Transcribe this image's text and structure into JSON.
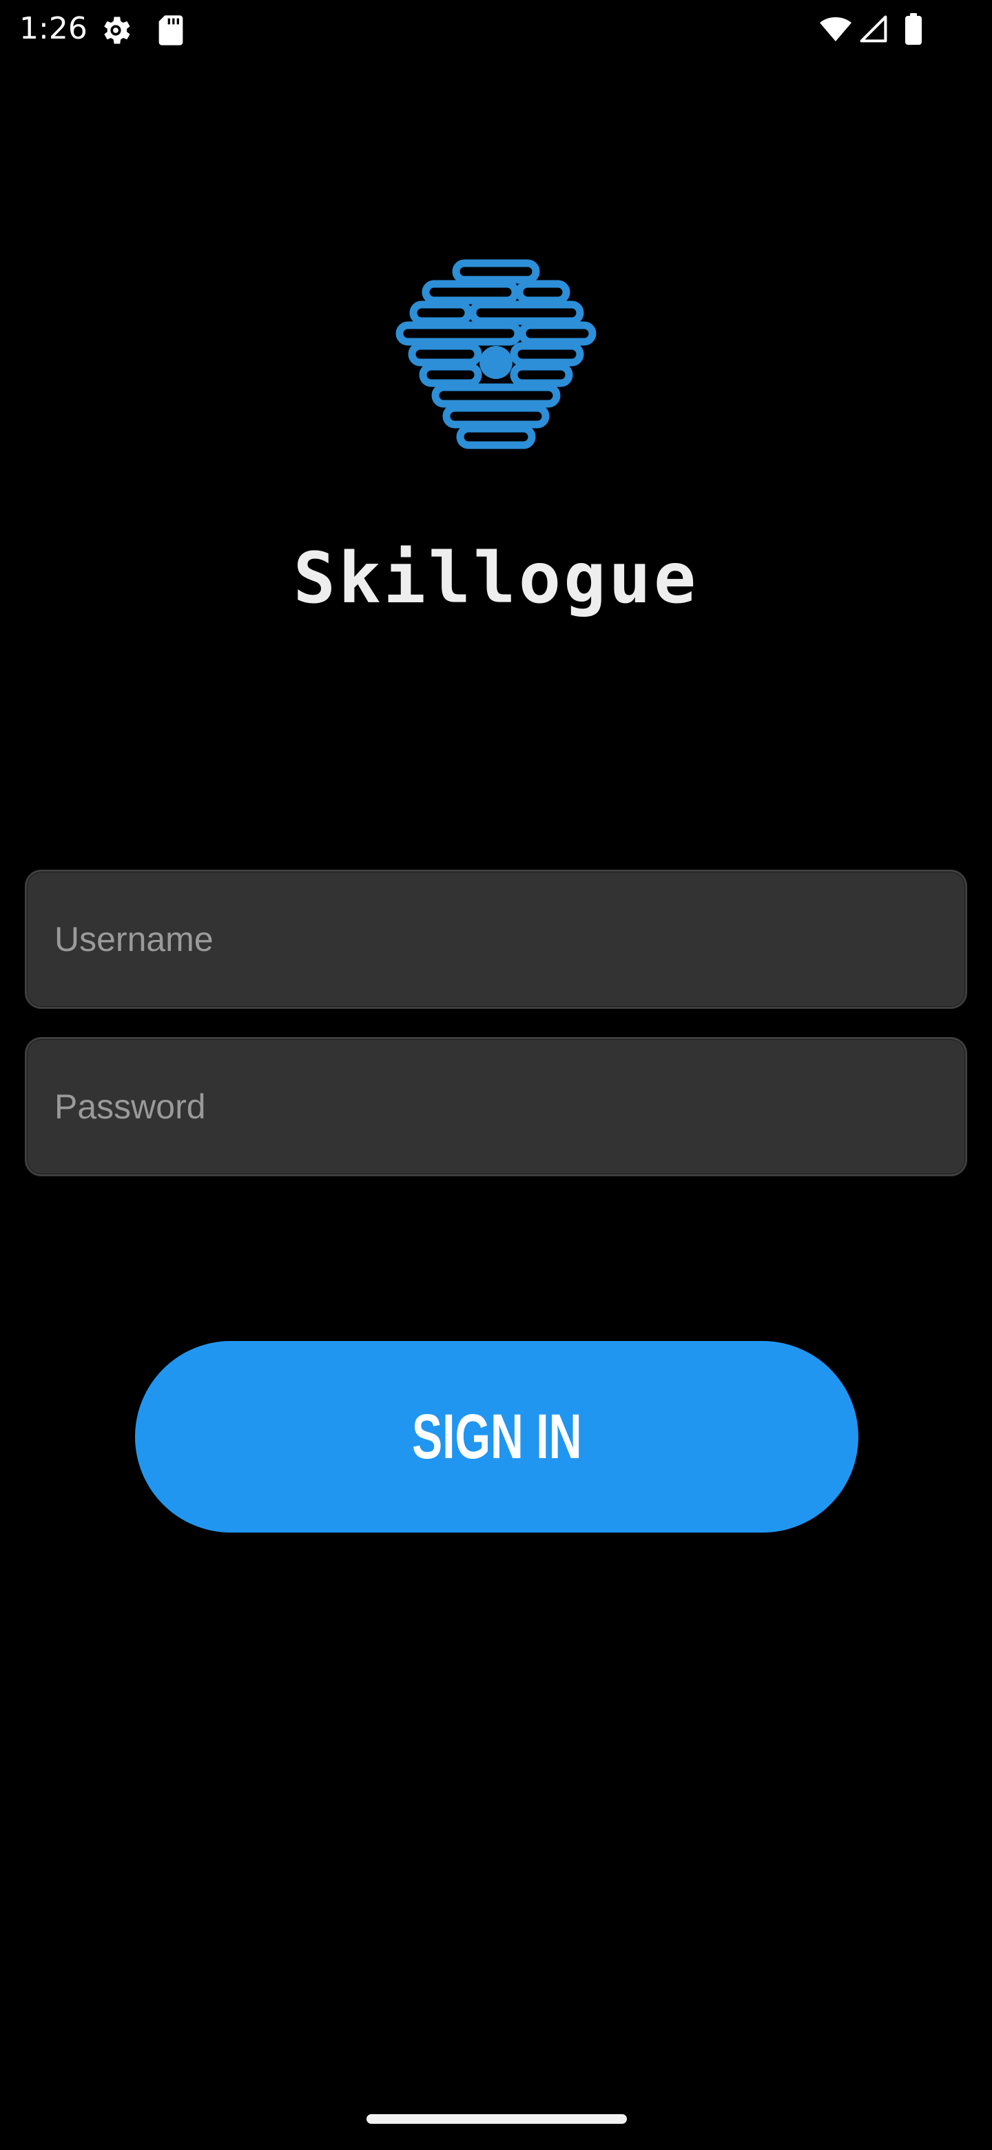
{
  "status_bar": {
    "time": "1:26",
    "icons_left": [
      "settings-icon",
      "sd-card-icon"
    ],
    "icons_right": [
      "wifi-icon",
      "cellular-signal-icon",
      "battery-icon"
    ]
  },
  "app": {
    "name": "Skillogue",
    "logo_icon": "hive-brain-logo-icon",
    "accent_color": "#2196f0"
  },
  "form": {
    "username": {
      "placeholder": "Username",
      "value": ""
    },
    "password": {
      "placeholder": "Password",
      "value": ""
    },
    "sign_in_label": "SIGN IN"
  },
  "colors": {
    "background": "#000000",
    "field_background": "#333333",
    "placeholder": "#9a9a9a",
    "button": "#2196f0"
  }
}
